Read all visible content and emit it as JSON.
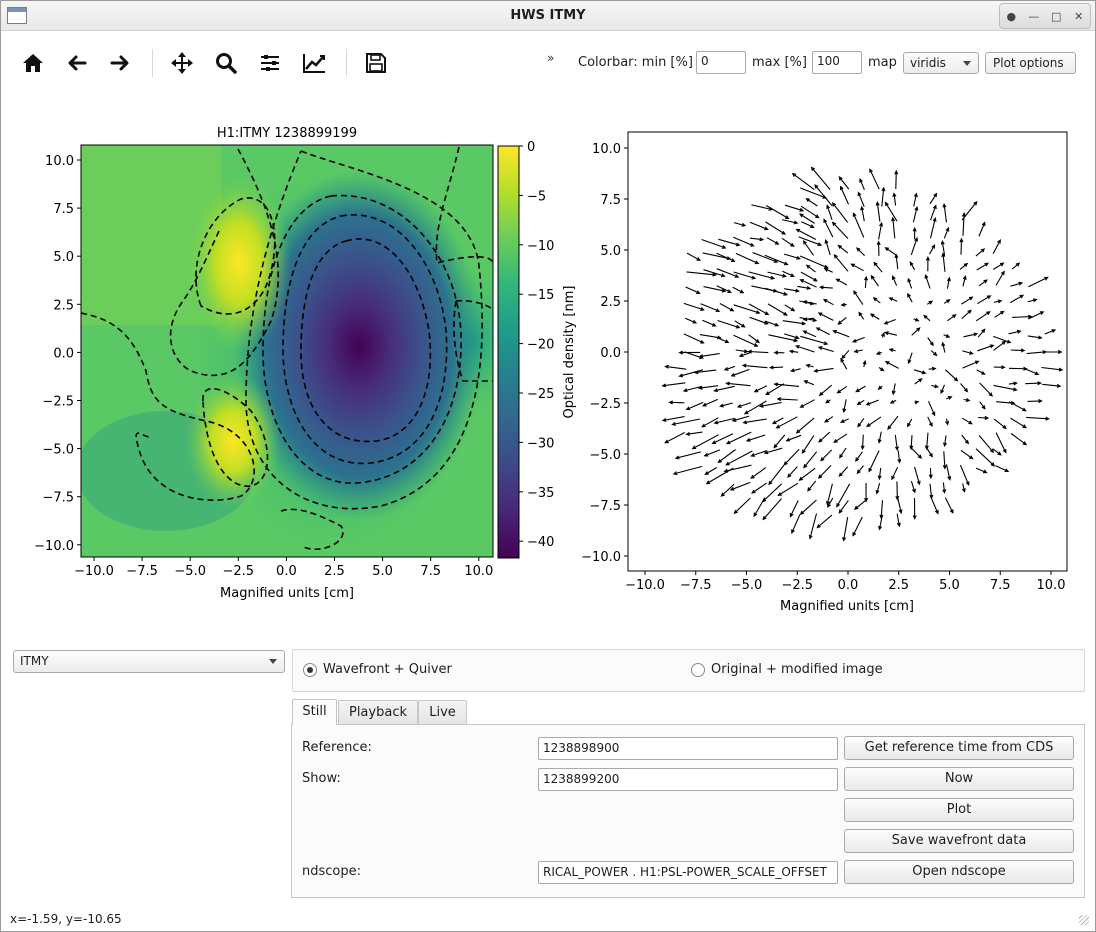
{
  "window": {
    "title": "HWS ITMY"
  },
  "toolbar": {
    "icons": [
      "home-icon",
      "back-arrow-icon",
      "forward-arrow-icon",
      "pan-move-icon",
      "zoom-magnifier-icon",
      "subplot-config-icon",
      "axes-line-edit-icon",
      "save-disk-icon"
    ],
    "overflow_glyph": "»"
  },
  "colorbar_controls": {
    "min_label": "Colorbar: min [%]",
    "min_value": "0",
    "max_label": "max [%]",
    "max_value": "100",
    "map_label": "map",
    "map_value": "viridis",
    "plot_options_label": "Plot options"
  },
  "left_plot": {
    "title": "H1:ITMY 1238899199",
    "xlabel": "Magnified units [cm]",
    "xticks": [
      "−10.0",
      "−7.5",
      "−5.0",
      "−2.5",
      "0.0",
      "2.5",
      "5.0",
      "7.5",
      "10.0"
    ],
    "yticks": [
      "10.0",
      "7.5",
      "5.0",
      "2.5",
      "0.0",
      "−2.5",
      "−5.0",
      "−7.5",
      "−10.0"
    ],
    "colorbar_label": "Optical density [nm]",
    "colorbar_ticks": [
      "0",
      "−5",
      "−10",
      "−15",
      "−20",
      "−25",
      "−30",
      "−35",
      "−40"
    ],
    "colormap": [
      "#fde725",
      "#b5de2b",
      "#6ece58",
      "#35b779",
      "#1f9e89",
      "#26828e",
      "#31688e",
      "#3e4989",
      "#482878",
      "#440154"
    ]
  },
  "right_plot": {
    "xlabel": "Magnified units [cm]",
    "xticks": [
      "−10.0",
      "−7.5",
      "−5.0",
      "−2.5",
      "0.0",
      "2.5",
      "5.0",
      "7.5",
      "10.0"
    ],
    "yticks": [
      "10.0",
      "7.5",
      "5.0",
      "2.5",
      "0.0",
      "−2.5",
      "−5.0",
      "−7.5",
      "−10.0"
    ]
  },
  "chart_data": [
    {
      "type": "heatmap",
      "title": "H1:ITMY 1238899199",
      "xlabel": "Magnified units [cm]",
      "ylabel": "",
      "xlim": [
        -10.5,
        10.5
      ],
      "ylim": [
        -10.5,
        10.5
      ],
      "colorbar": {
        "label": "Optical density [nm]",
        "range": [
          -42,
          0
        ],
        "cmap": "viridis"
      },
      "features": [
        {
          "kind": "minimum",
          "x": 3.5,
          "y": 0.0,
          "value": -42
        },
        {
          "kind": "maximum",
          "x": -2.0,
          "y": 4.5,
          "value": -2
        },
        {
          "kind": "maximum",
          "x": -2.5,
          "y": -5.0,
          "value": -5
        }
      ],
      "contours": "dashed black"
    },
    {
      "type": "scatter",
      "subtype": "quiver",
      "xlabel": "Magnified units [cm]",
      "xlim": [
        -11,
        11
      ],
      "ylim": [
        -10.5,
        10.5
      ],
      "aperture_radius": 8.3
    }
  ],
  "device_select": {
    "value": "ITMY"
  },
  "mode": {
    "option1": "Wavefront + Quiver",
    "option2": "Original + modified image",
    "selected": "Wavefront + Quiver"
  },
  "tabs": [
    "Still",
    "Playback",
    "Live"
  ],
  "still": {
    "reference_label": "Reference:",
    "reference_value": "1238898900",
    "show_label": "Show:",
    "show_value": "1238899200",
    "ndscope_label": "ndscope:",
    "ndscope_value": "RICAL_POWER . H1:PSL-POWER_SCALE_OFFSET",
    "btn_ref": "Get reference time from CDS",
    "btn_now": "Now",
    "btn_plot": "Plot",
    "btn_save": "Save wavefront data",
    "btn_ndscope": "Open ndscope"
  },
  "status": {
    "coords": "x=-1.59, y=-10.65"
  }
}
